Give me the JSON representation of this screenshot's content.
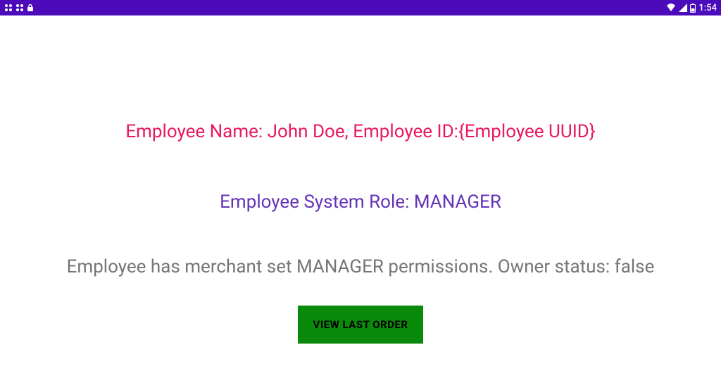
{
  "status_bar": {
    "time": "1:54"
  },
  "employee": {
    "name_line": "Employee Name: John Doe, Employee ID:{Employee UUID}",
    "role_line": "Employee System Role: MANAGER",
    "permissions_line": "Employee has merchant set MANAGER permissions. Owner status: false"
  },
  "button": {
    "view_last_order": "VIEW LAST ORDER"
  }
}
